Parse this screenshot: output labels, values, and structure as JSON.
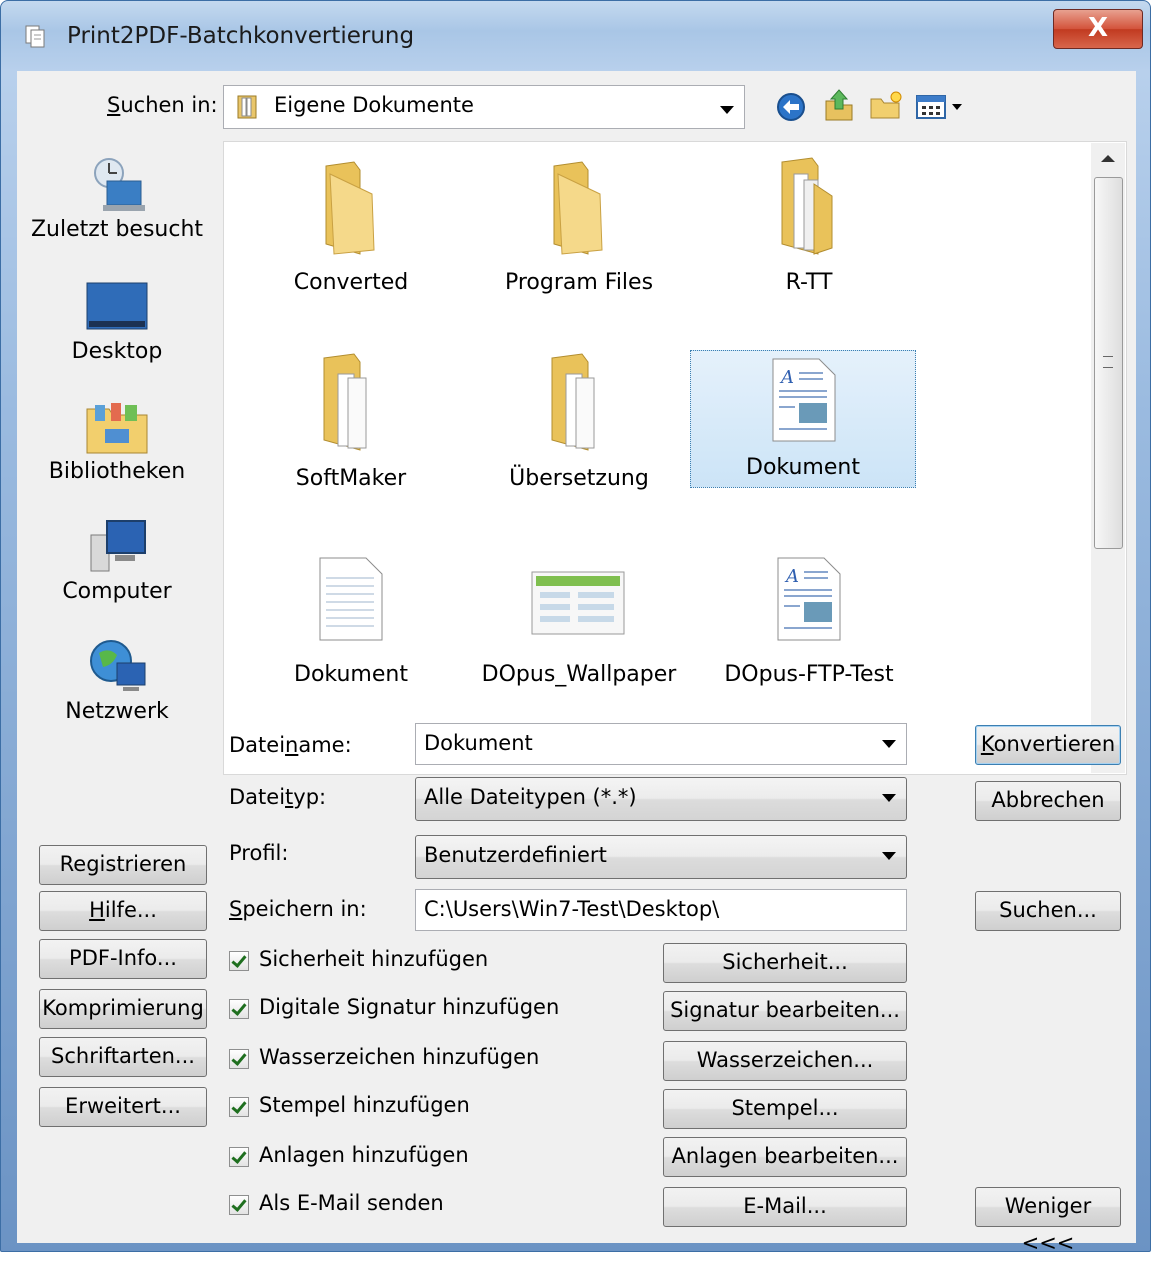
{
  "window": {
    "title": "Print2PDF-Batchkonvertierung",
    "close_label": "X"
  },
  "look_in": {
    "label_prefix": "S",
    "label_rest": "uchen in:",
    "value": "Eigene Dokumente"
  },
  "toolbar_icons": [
    "back-icon",
    "up-folder-icon",
    "new-folder-icon",
    "view-menu-icon"
  ],
  "places": [
    {
      "label": "Zuletzt besucht",
      "icon": "recent-places-icon"
    },
    {
      "label": "Desktop",
      "icon": "desktop-icon"
    },
    {
      "label": "Bibliotheken",
      "icon": "libraries-icon"
    },
    {
      "label": "Computer",
      "icon": "computer-icon"
    },
    {
      "label": "Netzwerk",
      "icon": "network-icon"
    }
  ],
  "files": [
    {
      "name": "Converted",
      "icon": "folder-icon"
    },
    {
      "name": "Program Files",
      "icon": "folder-icon"
    },
    {
      "name": "R-TT",
      "icon": "folder-with-files-icon"
    },
    {
      "name": "SoftMaker",
      "icon": "folder-with-files-icon"
    },
    {
      "name": "Übersetzung",
      "icon": "folder-with-files-icon"
    },
    {
      "name": "Dokument",
      "icon": "word-document-icon",
      "selected": true
    },
    {
      "name": "Dokument",
      "icon": "text-document-icon"
    },
    {
      "name": "DOpus_Wallpaper",
      "icon": "image-file-icon"
    },
    {
      "name": "DOpus-FTP-Test",
      "icon": "word-document-icon"
    }
  ],
  "fields": {
    "filename": {
      "label_a": "Datei",
      "label_u": "n",
      "label_b": "ame:",
      "value": "Dokument"
    },
    "filetype": {
      "label_a": "Datei",
      "label_u": "t",
      "label_b": "yp:",
      "value": "Alle Dateitypen (*.*)"
    },
    "profile": {
      "label": "Profil:",
      "value": "Benutzerdefiniert"
    },
    "save_in": {
      "label_u": "S",
      "label_b": "peichern in:",
      "value": "C:\\Users\\Win7-Test\\Desktop\\"
    }
  },
  "right_buttons": {
    "convert_u": "K",
    "convert_a": "o",
    "convert_b": "nvertieren",
    "cancel": "Abbrechen",
    "search": "Suchen...",
    "less": "Weniger <<<"
  },
  "left_buttons": {
    "register": "Registrieren",
    "help_u": "H",
    "help_b": "ilfe...",
    "pdf_info": "PDF-Info...",
    "compression": "Komprimierung",
    "fonts": "Schriftarten...",
    "advanced": "Erweitert..."
  },
  "options": [
    {
      "label": "Sicherheit hinzufügen",
      "checked": true,
      "button": "Sicherheit..."
    },
    {
      "label": "Digitale Signatur hinzufügen",
      "checked": true,
      "button": "Signatur bearbeiten..."
    },
    {
      "label": "Wasserzeichen hinzufügen",
      "checked": true,
      "button": "Wasserzeichen..."
    },
    {
      "label": "Stempel hinzufügen",
      "checked": true,
      "button": "Stempel..."
    },
    {
      "label": "Anlagen hinzufügen",
      "checked": true,
      "button": "Anlagen bearbeiten..."
    },
    {
      "label": "Als E-Mail senden",
      "checked": true,
      "button": "E-Mail..."
    }
  ]
}
